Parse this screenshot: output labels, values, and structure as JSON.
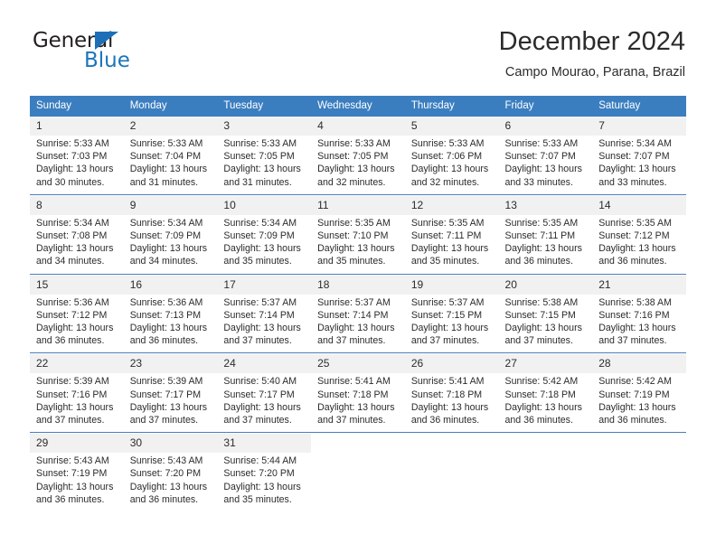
{
  "logo": {
    "text_primary": "General",
    "text_secondary": "Blue",
    "triangle_icon": "blue-triangle-icon",
    "color_primary": "#231f20",
    "color_secondary": "#1b75bb"
  },
  "header": {
    "title": "December 2024",
    "subtitle": "Campo Mourao, Parana, Brazil"
  },
  "colors": {
    "header_blue": "#3b7ec0",
    "daynum_background": "#f1f1f1",
    "week_separator": "#4a7ebb",
    "text": "#2b2b2b"
  },
  "calendar": {
    "weekday_headers": [
      "Sunday",
      "Monday",
      "Tuesday",
      "Wednesday",
      "Thursday",
      "Friday",
      "Saturday"
    ],
    "weeks": [
      {
        "days": [
          {
            "day": "1",
            "sunrise": "Sunrise: 5:33 AM",
            "sunset": "Sunset: 7:03 PM",
            "daylight_1": "Daylight: 13 hours",
            "daylight_2": "and 30 minutes."
          },
          {
            "day": "2",
            "sunrise": "Sunrise: 5:33 AM",
            "sunset": "Sunset: 7:04 PM",
            "daylight_1": "Daylight: 13 hours",
            "daylight_2": "and 31 minutes."
          },
          {
            "day": "3",
            "sunrise": "Sunrise: 5:33 AM",
            "sunset": "Sunset: 7:05 PM",
            "daylight_1": "Daylight: 13 hours",
            "daylight_2": "and 31 minutes."
          },
          {
            "day": "4",
            "sunrise": "Sunrise: 5:33 AM",
            "sunset": "Sunset: 7:05 PM",
            "daylight_1": "Daylight: 13 hours",
            "daylight_2": "and 32 minutes."
          },
          {
            "day": "5",
            "sunrise": "Sunrise: 5:33 AM",
            "sunset": "Sunset: 7:06 PM",
            "daylight_1": "Daylight: 13 hours",
            "daylight_2": "and 32 minutes."
          },
          {
            "day": "6",
            "sunrise": "Sunrise: 5:33 AM",
            "sunset": "Sunset: 7:07 PM",
            "daylight_1": "Daylight: 13 hours",
            "daylight_2": "and 33 minutes."
          },
          {
            "day": "7",
            "sunrise": "Sunrise: 5:34 AM",
            "sunset": "Sunset: 7:07 PM",
            "daylight_1": "Daylight: 13 hours",
            "daylight_2": "and 33 minutes."
          }
        ]
      },
      {
        "days": [
          {
            "day": "8",
            "sunrise": "Sunrise: 5:34 AM",
            "sunset": "Sunset: 7:08 PM",
            "daylight_1": "Daylight: 13 hours",
            "daylight_2": "and 34 minutes."
          },
          {
            "day": "9",
            "sunrise": "Sunrise: 5:34 AM",
            "sunset": "Sunset: 7:09 PM",
            "daylight_1": "Daylight: 13 hours",
            "daylight_2": "and 34 minutes."
          },
          {
            "day": "10",
            "sunrise": "Sunrise: 5:34 AM",
            "sunset": "Sunset: 7:09 PM",
            "daylight_1": "Daylight: 13 hours",
            "daylight_2": "and 35 minutes."
          },
          {
            "day": "11",
            "sunrise": "Sunrise: 5:35 AM",
            "sunset": "Sunset: 7:10 PM",
            "daylight_1": "Daylight: 13 hours",
            "daylight_2": "and 35 minutes."
          },
          {
            "day": "12",
            "sunrise": "Sunrise: 5:35 AM",
            "sunset": "Sunset: 7:11 PM",
            "daylight_1": "Daylight: 13 hours",
            "daylight_2": "and 35 minutes."
          },
          {
            "day": "13",
            "sunrise": "Sunrise: 5:35 AM",
            "sunset": "Sunset: 7:11 PM",
            "daylight_1": "Daylight: 13 hours",
            "daylight_2": "and 36 minutes."
          },
          {
            "day": "14",
            "sunrise": "Sunrise: 5:35 AM",
            "sunset": "Sunset: 7:12 PM",
            "daylight_1": "Daylight: 13 hours",
            "daylight_2": "and 36 minutes."
          }
        ]
      },
      {
        "days": [
          {
            "day": "15",
            "sunrise": "Sunrise: 5:36 AM",
            "sunset": "Sunset: 7:12 PM",
            "daylight_1": "Daylight: 13 hours",
            "daylight_2": "and 36 minutes."
          },
          {
            "day": "16",
            "sunrise": "Sunrise: 5:36 AM",
            "sunset": "Sunset: 7:13 PM",
            "daylight_1": "Daylight: 13 hours",
            "daylight_2": "and 36 minutes."
          },
          {
            "day": "17",
            "sunrise": "Sunrise: 5:37 AM",
            "sunset": "Sunset: 7:14 PM",
            "daylight_1": "Daylight: 13 hours",
            "daylight_2": "and 37 minutes."
          },
          {
            "day": "18",
            "sunrise": "Sunrise: 5:37 AM",
            "sunset": "Sunset: 7:14 PM",
            "daylight_1": "Daylight: 13 hours",
            "daylight_2": "and 37 minutes."
          },
          {
            "day": "19",
            "sunrise": "Sunrise: 5:37 AM",
            "sunset": "Sunset: 7:15 PM",
            "daylight_1": "Daylight: 13 hours",
            "daylight_2": "and 37 minutes."
          },
          {
            "day": "20",
            "sunrise": "Sunrise: 5:38 AM",
            "sunset": "Sunset: 7:15 PM",
            "daylight_1": "Daylight: 13 hours",
            "daylight_2": "and 37 minutes."
          },
          {
            "day": "21",
            "sunrise": "Sunrise: 5:38 AM",
            "sunset": "Sunset: 7:16 PM",
            "daylight_1": "Daylight: 13 hours",
            "daylight_2": "and 37 minutes."
          }
        ]
      },
      {
        "days": [
          {
            "day": "22",
            "sunrise": "Sunrise: 5:39 AM",
            "sunset": "Sunset: 7:16 PM",
            "daylight_1": "Daylight: 13 hours",
            "daylight_2": "and 37 minutes."
          },
          {
            "day": "23",
            "sunrise": "Sunrise: 5:39 AM",
            "sunset": "Sunset: 7:17 PM",
            "daylight_1": "Daylight: 13 hours",
            "daylight_2": "and 37 minutes."
          },
          {
            "day": "24",
            "sunrise": "Sunrise: 5:40 AM",
            "sunset": "Sunset: 7:17 PM",
            "daylight_1": "Daylight: 13 hours",
            "daylight_2": "and 37 minutes."
          },
          {
            "day": "25",
            "sunrise": "Sunrise: 5:41 AM",
            "sunset": "Sunset: 7:18 PM",
            "daylight_1": "Daylight: 13 hours",
            "daylight_2": "and 37 minutes."
          },
          {
            "day": "26",
            "sunrise": "Sunrise: 5:41 AM",
            "sunset": "Sunset: 7:18 PM",
            "daylight_1": "Daylight: 13 hours",
            "daylight_2": "and 36 minutes."
          },
          {
            "day": "27",
            "sunrise": "Sunrise: 5:42 AM",
            "sunset": "Sunset: 7:18 PM",
            "daylight_1": "Daylight: 13 hours",
            "daylight_2": "and 36 minutes."
          },
          {
            "day": "28",
            "sunrise": "Sunrise: 5:42 AM",
            "sunset": "Sunset: 7:19 PM",
            "daylight_1": "Daylight: 13 hours",
            "daylight_2": "and 36 minutes."
          }
        ]
      },
      {
        "days": [
          {
            "day": "29",
            "sunrise": "Sunrise: 5:43 AM",
            "sunset": "Sunset: 7:19 PM",
            "daylight_1": "Daylight: 13 hours",
            "daylight_2": "and 36 minutes."
          },
          {
            "day": "30",
            "sunrise": "Sunrise: 5:43 AM",
            "sunset": "Sunset: 7:20 PM",
            "daylight_1": "Daylight: 13 hours",
            "daylight_2": "and 36 minutes."
          },
          {
            "day": "31",
            "sunrise": "Sunrise: 5:44 AM",
            "sunset": "Sunset: 7:20 PM",
            "daylight_1": "Daylight: 13 hours",
            "daylight_2": "and 35 minutes."
          },
          {
            "day": "",
            "sunrise": "",
            "sunset": "",
            "daylight_1": "",
            "daylight_2": ""
          },
          {
            "day": "",
            "sunrise": "",
            "sunset": "",
            "daylight_1": "",
            "daylight_2": ""
          },
          {
            "day": "",
            "sunrise": "",
            "sunset": "",
            "daylight_1": "",
            "daylight_2": ""
          },
          {
            "day": "",
            "sunrise": "",
            "sunset": "",
            "daylight_1": "",
            "daylight_2": ""
          }
        ]
      }
    ]
  }
}
